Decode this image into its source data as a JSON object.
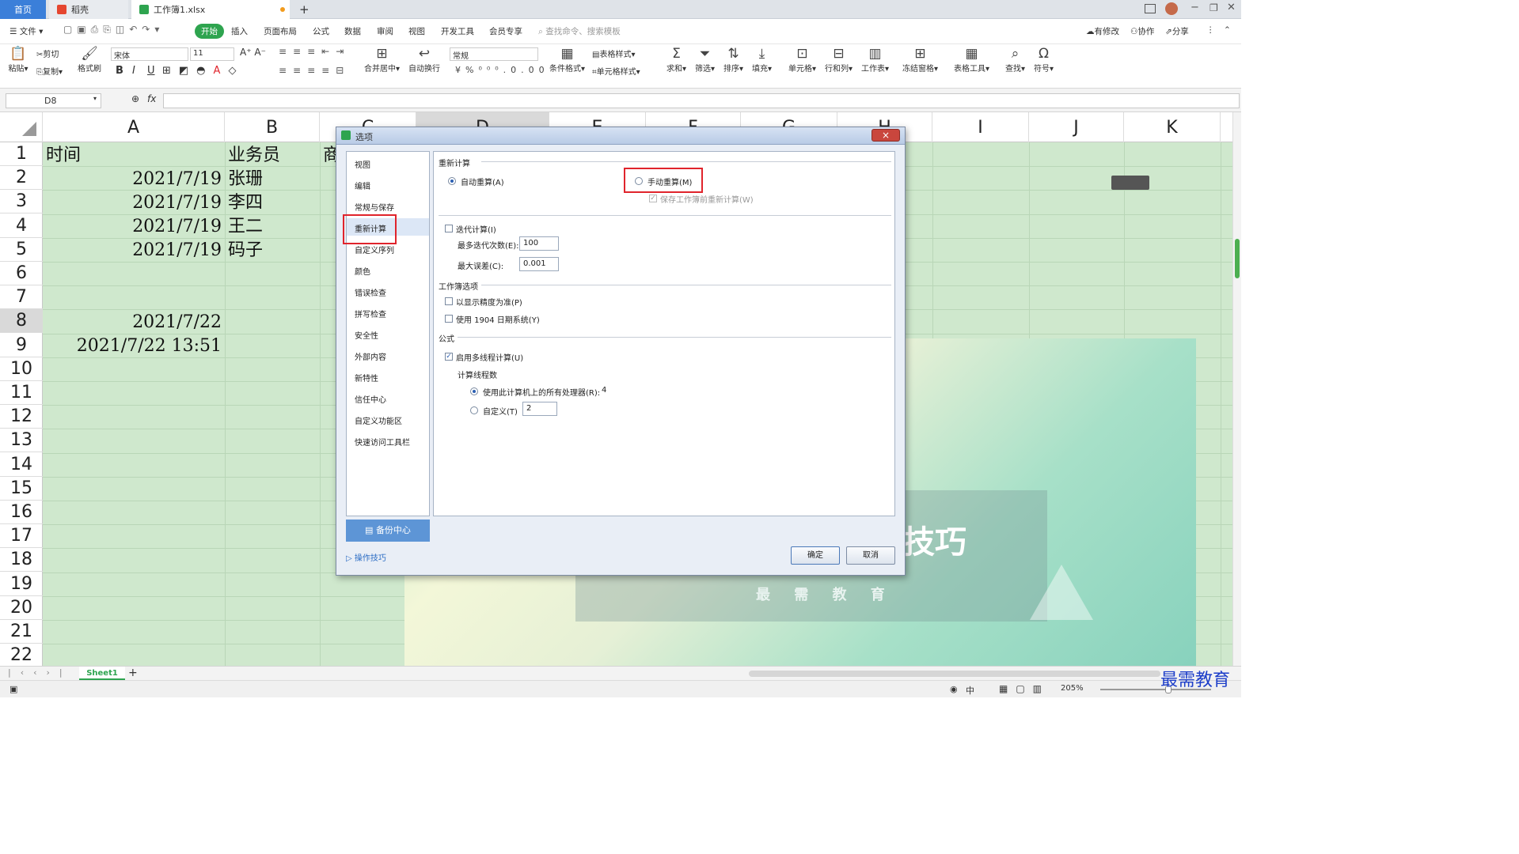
{
  "tabs": {
    "home": "首页",
    "daoke": "稻壳",
    "workbook": "工作簿1.xlsx",
    "new_tab": "+"
  },
  "menu": {
    "file": "文件",
    "start": "开始",
    "insert": "插入",
    "layout": "页面布局",
    "formula": "公式",
    "data": "数据",
    "review": "审阅",
    "view": "视图",
    "dev": "开发工具",
    "member": "会员专享",
    "search_placeholder": "查找命令、搜索模板",
    "modified": "有修改",
    "collab": "协作",
    "share": "分享"
  },
  "ribbon": {
    "paste": "粘贴",
    "cut": "剪切",
    "copy": "复制",
    "format_painter": "格式刷",
    "font": "宋体",
    "size": "11",
    "bold": "B",
    "italic": "I",
    "underline": "U",
    "merge": "合并居中",
    "wrap": "自动换行",
    "numfmt": "常规",
    "cond_fmt": "条件格式",
    "table_style": "表格样式",
    "cell_style": "单元格样式",
    "sum": "求和",
    "filter": "筛选",
    "sort": "排序",
    "fill": "填充",
    "cell": "单元格",
    "rowcol": "行和列",
    "sheet": "工作表",
    "freeze": "冻结窗格",
    "table_tool": "表格工具",
    "find": "查找",
    "symbol": "符号"
  },
  "formula_bar": {
    "cell_ref": "D8",
    "fx": "fx"
  },
  "columns": [
    "A",
    "B",
    "C",
    "D",
    "E",
    "F",
    "G",
    "H",
    "I",
    "J",
    "K"
  ],
  "rows": [
    "1",
    "2",
    "3",
    "4",
    "5",
    "6",
    "7",
    "8",
    "9",
    "10",
    "11",
    "12",
    "13",
    "14",
    "15",
    "16",
    "17",
    "18",
    "19",
    "20",
    "21",
    "22"
  ],
  "cells": {
    "a1": "时间",
    "b1": "业务员",
    "c1": "商",
    "a2": "2021/7/19",
    "b2": "张珊",
    "a3": "2021/7/19",
    "b3": "李四",
    "a4": "2021/7/19",
    "b4": "王二",
    "a5": "2021/7/19",
    "b5": "码子",
    "a8": "2021/7/22",
    "a9": "2021/7/22  13:51"
  },
  "banner": {
    "title": "技巧",
    "subtitle": "最 需 教 育"
  },
  "dialog": {
    "title": "选项",
    "close": "×",
    "nav": [
      "视图",
      "编辑",
      "常规与保存",
      "重新计算",
      "自定义序列",
      "颜色",
      "错误检查",
      "拼写检查",
      "安全性",
      "外部内容",
      "新特性",
      "信任中心",
      "自定义功能区",
      "快速访问工具栏"
    ],
    "backup": "备份中心",
    "tips": "操作技巧",
    "recalc_group": "重新计算",
    "auto": "自动重算(A)",
    "manual": "手动重算(M)",
    "save_recalc": "保存工作簿前重新计算(W)",
    "iter": "迭代计算(I)",
    "max_iter_label": "最多迭代次数(E):",
    "max_iter": "100",
    "max_change_label": "最大误差(C):",
    "max_change": "0.001",
    "wb_group": "工作簿选项",
    "precision": "以显示精度为准(P)",
    "date1904": "使用 1904 日期系统(Y)",
    "formula_group": "公式",
    "multithread": "启用多线程计算(U)",
    "threads_label": "计算线程数",
    "use_all": "使用此计算机上的所有处理器(R):",
    "processors": "4",
    "custom": "自定义(T)",
    "custom_val": "2",
    "ok": "确定",
    "cancel": "取消"
  },
  "sheet": {
    "name": "Sheet1",
    "add": "+"
  },
  "status": {
    "zoom": "205%",
    "lang": "中"
  },
  "watermark": "最需教育"
}
